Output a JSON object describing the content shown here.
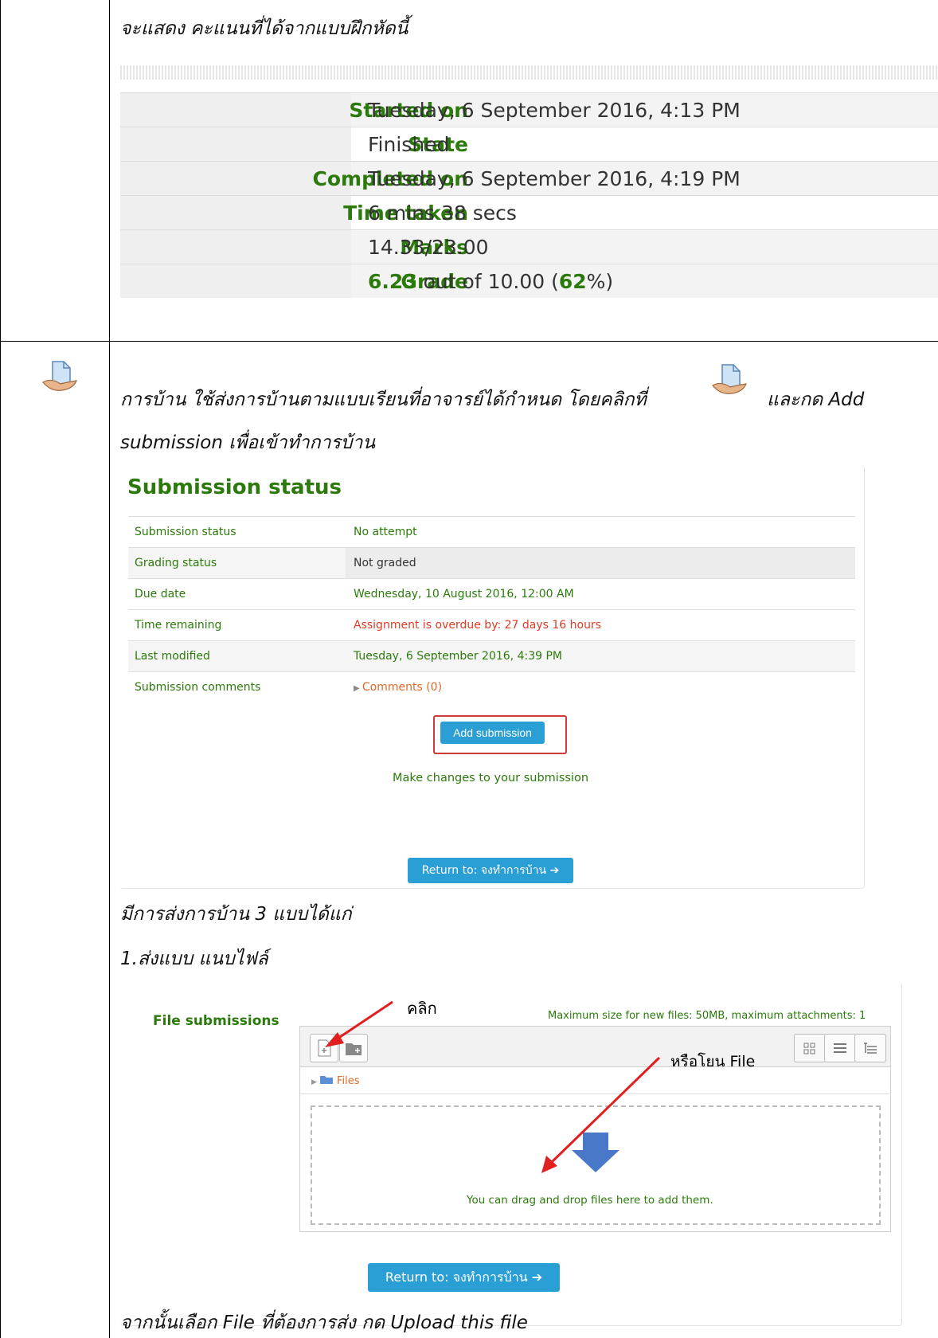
{
  "intro_text": "จะแสดง คะแนนที่ได้จากแบบฝึกหัดนี้",
  "quiz_summary": [
    {
      "label": "Started on",
      "value": "Tuesday, 6 September 2016, 4:13 PM"
    },
    {
      "label": "State",
      "value": "Finished"
    },
    {
      "label": "Completed on",
      "value": "Tuesday, 6 September 2016, 4:19 PM"
    },
    {
      "label": "Time taken",
      "value": "6 mins 38 secs"
    },
    {
      "label": "Marks",
      "value": "14.33/23.00"
    },
    {
      "label": "Grade",
      "grade_value": "6.23",
      "grade_mid": " out of 10.00 (",
      "grade_pct": "62",
      "grade_end": "%)"
    }
  ],
  "assignment_desc_1": "การบ้าน ใช้ส่งการบ้านตามแบบเรียนที่อาจารย์ได้กำหนด โดยคลิกที่",
  "assignment_desc_2": "และกด Add",
  "assignment_desc_3": "submission เพื่อเข้าทำการบ้าน",
  "submission": {
    "heading": "Submission status",
    "rows": [
      {
        "label": "Submission status",
        "value": "No attempt"
      },
      {
        "label": "Grading status",
        "value": "Not graded"
      },
      {
        "label": "Due date",
        "value": "Wednesday, 10 August 2016, 12:00 AM"
      },
      {
        "label": "Time remaining",
        "value": "Assignment is overdue by: 27 days 16 hours"
      },
      {
        "label": "Last modified",
        "value": "Tuesday, 6 September 2016, 4:39 PM"
      },
      {
        "label": "Submission comments",
        "value": "Comments (0)"
      }
    ],
    "add_button": "Add submission",
    "make_changes": "Make changes to your submission",
    "return_button": "Return to: จงทำการบ้าน"
  },
  "methods_text": "มีการส่งการบ้าน 3 แบบได้แก่",
  "method_1": "1.ส่งแบบ แนบไฟล์",
  "file_submissions": {
    "label": "File submissions",
    "max_size": "Maximum size for new files: 50MB, maximum attachments: 1",
    "folder": "Files",
    "drop_text": "You can drag and drop files here to add them.",
    "return_button": "Return to: จงทำการบ้าน",
    "annotation_click": "คลิก",
    "annotation_drag": "หรือโยน File"
  },
  "footer_text": "จากนั้นเลือก File ที่ต้องการส่ง กด Upload this file",
  "colors": {
    "green": "#2b7a0b",
    "blue_button": "#2a9fd6",
    "red": "#e03a24",
    "arrow": "#e02020"
  }
}
